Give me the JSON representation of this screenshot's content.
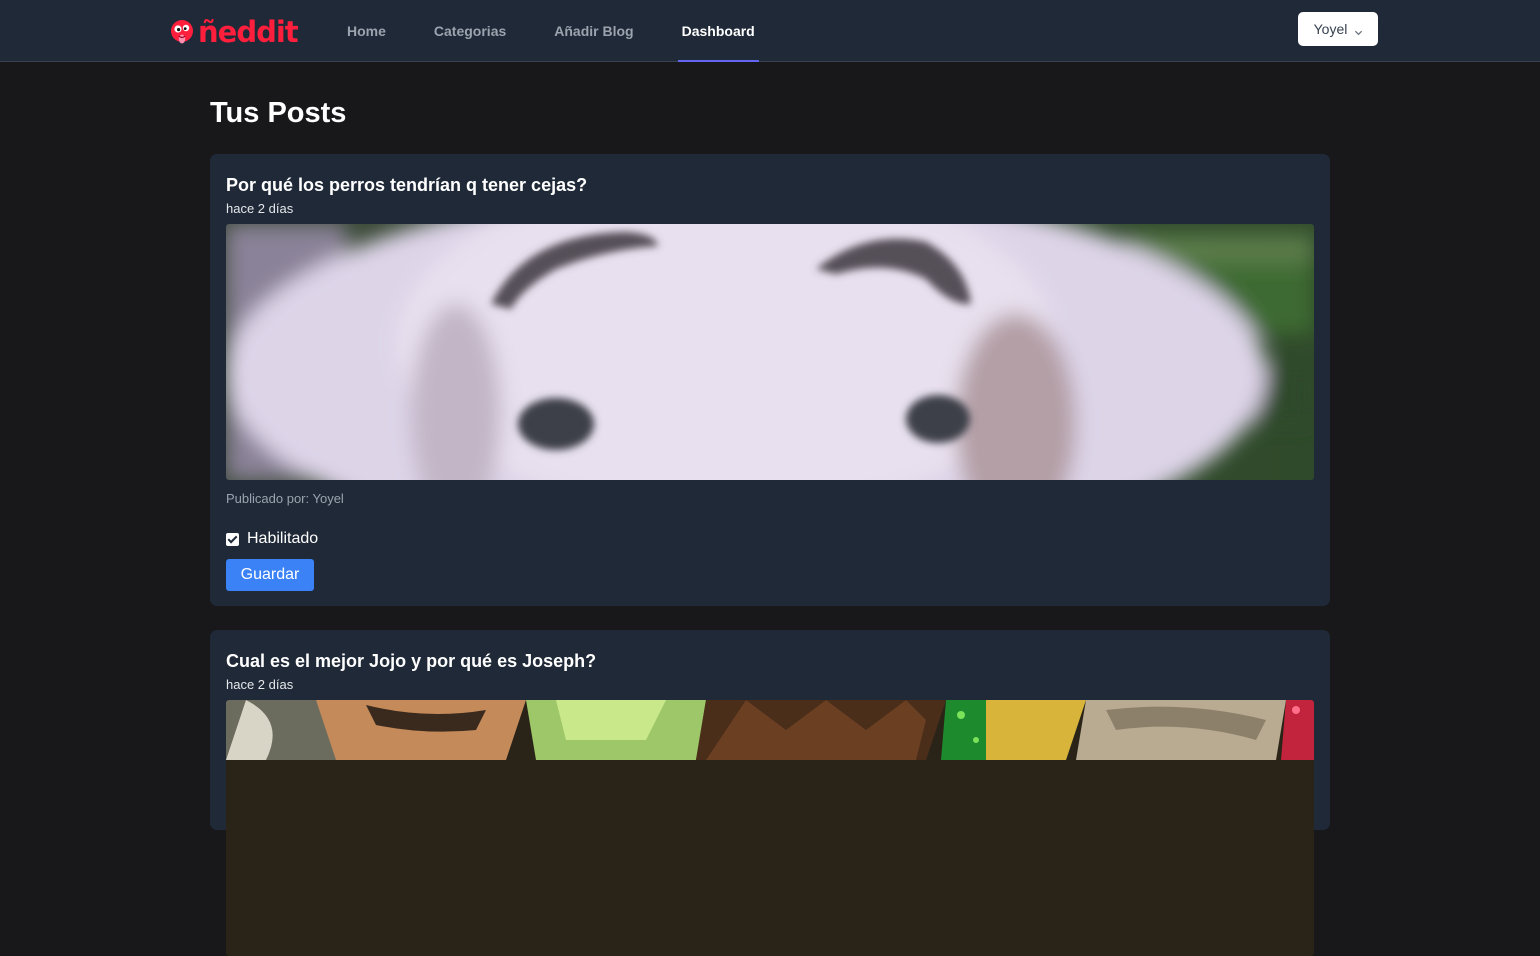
{
  "navbar": {
    "logo_text": "ñeddit",
    "links": [
      {
        "label": "Home",
        "active": false
      },
      {
        "label": "Categorias",
        "active": false
      },
      {
        "label": "Añadir Blog",
        "active": false
      },
      {
        "label": "Dashboard",
        "active": true
      }
    ],
    "user_menu": {
      "label": "Yoyel",
      "icon": "chevron-down-icon"
    }
  },
  "page": {
    "title": "Tus Posts"
  },
  "posts": [
    {
      "title": "Por qué los perros tendrían q tener cejas?",
      "time": "hace 2 días",
      "image": "dog-with-eyebrows-image",
      "author": "Publicado por: Yoyel",
      "enabled": true,
      "enabled_label": "Habilitado",
      "save_label": "Guardar"
    },
    {
      "title": "Cual es el mejor Jojo y por qué es Joseph?",
      "time": "hace 2 días",
      "image": "jojo-characters-image"
    }
  ],
  "colors": {
    "background": "#18181b",
    "navbar": "#1f2937",
    "card": "#1f2937",
    "accent_underline": "#6366f1",
    "button": "#3b82f6",
    "logo": "#ff1f3d"
  }
}
